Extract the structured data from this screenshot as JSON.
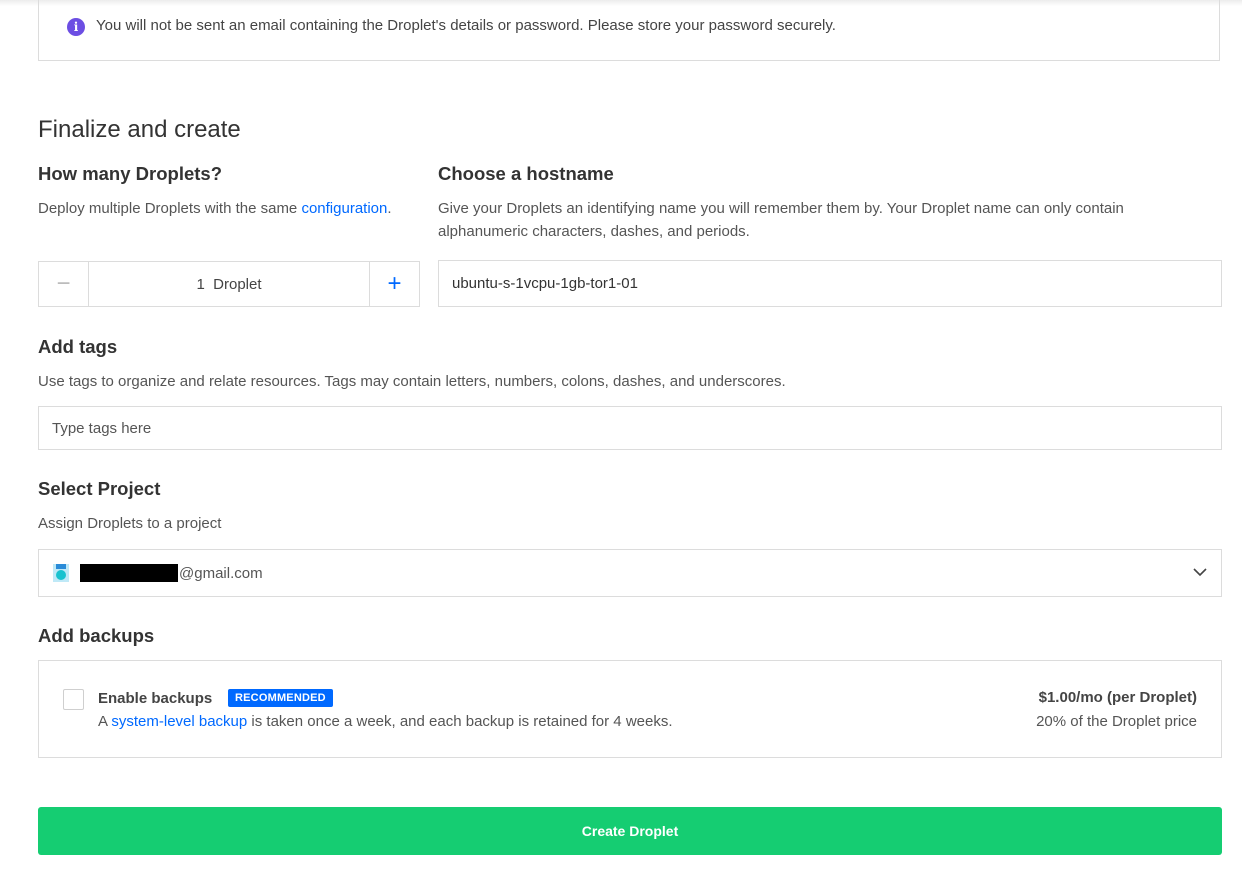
{
  "notice": {
    "icon": "info-icon",
    "text": "You will not be sent an email containing the Droplet's details or password. Please store your password securely."
  },
  "finalize": {
    "title": "Finalize and create",
    "count": {
      "heading": "How many Droplets?",
      "desc_prefix": "Deploy multiple Droplets with the same ",
      "desc_link": "configuration",
      "desc_suffix": ".",
      "value": "1",
      "unit": "Droplet",
      "minus_label": "−",
      "plus_label": "+"
    },
    "hostname": {
      "heading": "Choose a hostname",
      "desc": "Give your Droplets an identifying name you will remember them by. Your Droplet name can only contain alphanumeric characters, dashes, and periods.",
      "value": "ubuntu-s-1vcpu-1gb-tor1-01"
    }
  },
  "tags": {
    "heading": "Add tags",
    "desc": "Use tags to organize and relate resources. Tags may contain letters, numbers, colons, dashes, and underscores.",
    "placeholder": "Type tags here"
  },
  "project": {
    "heading": "Select Project",
    "desc": "Assign Droplets to a project",
    "selected": "@gmail.com",
    "icon": "project-icon"
  },
  "backups": {
    "heading": "Add backups",
    "option_label": "Enable backups",
    "badge": "RECOMMENDED",
    "desc_prefix": "A ",
    "desc_link": "system-level backup",
    "desc_suffix": " is taken once a week, and each backup is retained for 4 weeks.",
    "price": "$1.00/mo (per Droplet)",
    "price_note": "20% of the Droplet price",
    "checked": false
  },
  "actions": {
    "create_label": "Create Droplet"
  },
  "colors": {
    "accent": "#0069ff",
    "create_button": "#15cd72",
    "info_icon": "#6c4ee3"
  }
}
